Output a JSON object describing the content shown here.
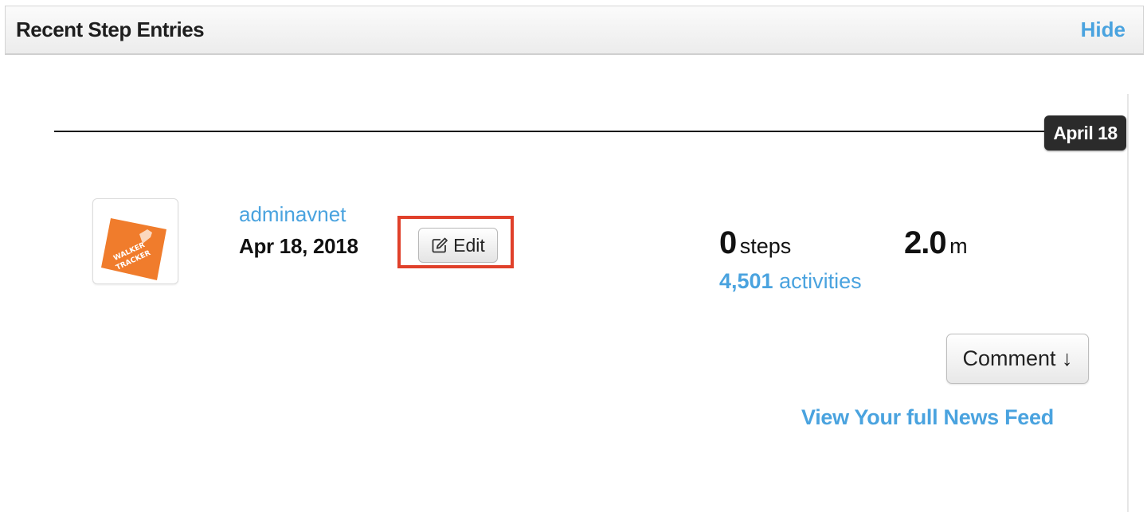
{
  "panel": {
    "title": "Recent Step Entries",
    "hide_label": "Hide"
  },
  "timeline": {
    "date_tag": "April 18"
  },
  "entry": {
    "avatar_logo_text": "WALKER TRACKER",
    "username": "adminavnet",
    "date": "Apr 18, 2018",
    "edit_label": "Edit",
    "steps_value": "0",
    "steps_unit": "steps",
    "distance_value": "2.0",
    "distance_unit": "m",
    "activities_count": "4,501",
    "activities_label": "activities",
    "comment_label": "Comment ↓"
  },
  "footer": {
    "newsfeed_label": "View Your full News Feed"
  },
  "colors": {
    "link": "#4aa3df",
    "highlight": "#e0402a",
    "date_tag_bg": "#2b2b2b",
    "logo_orange": "#f07c2c"
  },
  "icons": {
    "edit": "pencil-square-icon",
    "logo": "walker-tracker-logo"
  }
}
